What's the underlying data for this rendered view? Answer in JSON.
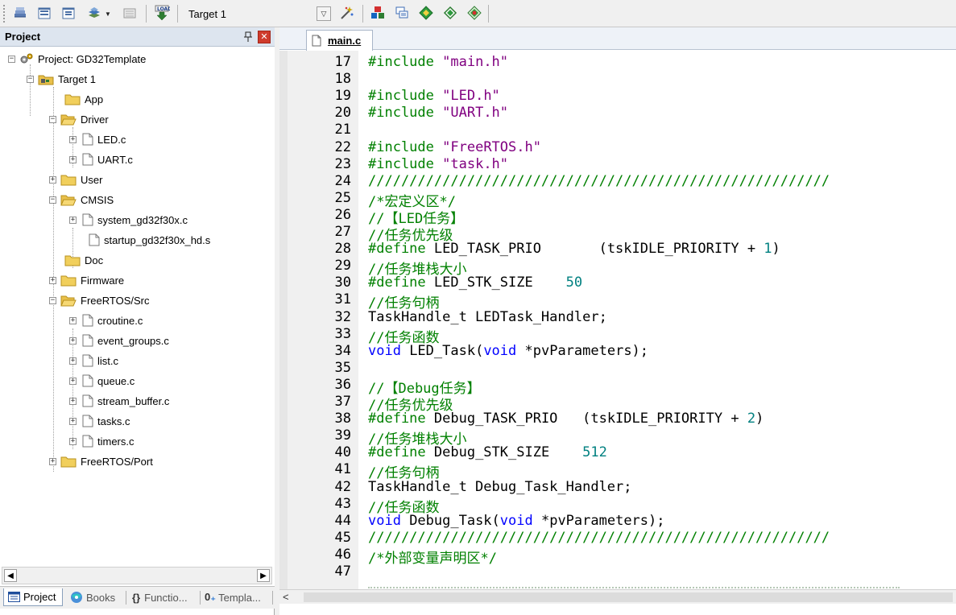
{
  "toolbar": {
    "target_label": "Target 1",
    "icons": [
      "build-all-icon",
      "translate-icon",
      "rebuild-icon",
      "batch-build-icon",
      "stop-build-icon",
      "download-icon",
      "manage-components-icon",
      "options-for-target-icon",
      "pack-installer-icon",
      "select-device-icon",
      "magic-wand-icon",
      "run-icon"
    ]
  },
  "project_panel": {
    "title": "Project",
    "tree": [
      {
        "label": "Project: GD32Template",
        "kind": "project"
      },
      {
        "label": "Target 1",
        "kind": "target"
      },
      {
        "label": "App",
        "kind": "folder"
      },
      {
        "label": "Driver",
        "kind": "folder"
      },
      {
        "label": "LED.c",
        "kind": "file"
      },
      {
        "label": "UART.c",
        "kind": "file"
      },
      {
        "label": "User",
        "kind": "folder"
      },
      {
        "label": "CMSIS",
        "kind": "folder"
      },
      {
        "label": "system_gd32f30x.c",
        "kind": "file"
      },
      {
        "label": "startup_gd32f30x_hd.s",
        "kind": "file"
      },
      {
        "label": "Doc",
        "kind": "folder"
      },
      {
        "label": "Firmware",
        "kind": "folder"
      },
      {
        "label": "FreeRTOS/Src",
        "kind": "folder"
      },
      {
        "label": "croutine.c",
        "kind": "file"
      },
      {
        "label": "event_groups.c",
        "kind": "file"
      },
      {
        "label": "list.c",
        "kind": "file"
      },
      {
        "label": "queue.c",
        "kind": "file"
      },
      {
        "label": "stream_buffer.c",
        "kind": "file"
      },
      {
        "label": "tasks.c",
        "kind": "file"
      },
      {
        "label": "timers.c",
        "kind": "file"
      },
      {
        "label": "FreeRTOS/Port",
        "kind": "folder"
      }
    ],
    "tabs": [
      "Project",
      "Books",
      "Functio...",
      "Templa..."
    ]
  },
  "editor": {
    "tab_label": "main.c",
    "line_numbers": [
      "17",
      "18",
      "19",
      "20",
      "21",
      "22",
      "23",
      "24",
      "25",
      "26",
      "27",
      "28",
      "29",
      "30",
      "31",
      "32",
      "33",
      "34",
      "35",
      "36",
      "37",
      "38",
      "39",
      "40",
      "41",
      "42",
      "43",
      "44",
      "45",
      "46",
      "47"
    ],
    "lines": [
      "#include \"main.h\"",
      "",
      "#include \"LED.h\"",
      "#include \"UART.h\"",
      "",
      "#include \"FreeRTOS.h\"",
      "#include \"task.h\"",
      "////////////////////////////////////////////////////////",
      "/*宏定义区*/",
      "//【LED任务】",
      "//任务优先级",
      "#define LED_TASK_PRIO       (tskIDLE_PRIORITY + 1)",
      "//任务堆栈大小",
      "#define LED_STK_SIZE    50",
      "//任务句柄",
      "TaskHandle_t LEDTask_Handler;",
      "//任务函数",
      "void LED_Task(void *pvParameters);",
      "",
      "//【Debug任务】",
      "//任务优先级",
      "#define Debug_TASK_PRIO   (tskIDLE_PRIORITY + 2)",
      "//任务堆栈大小",
      "#define Debug_STK_SIZE    512",
      "//任务句柄",
      "TaskHandle_t Debug_Task_Handler;",
      "//任务函数",
      "void Debug_Task(void *pvParameters);",
      "////////////////////////////////////////////////////////",
      "/*外部变量声明区*/",
      ""
    ]
  }
}
